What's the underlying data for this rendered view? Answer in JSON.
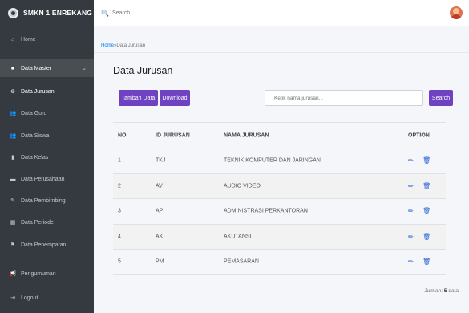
{
  "brand": {
    "name": "SMKN 1 ENREKANG"
  },
  "sidebar": {
    "items": [
      {
        "label": "Home",
        "icon": "home-icon",
        "glyph": "⌂"
      },
      {
        "label": "Data Master",
        "icon": "folder-icon",
        "glyph": "■"
      },
      {
        "label": "Data Jurusan",
        "icon": "compass-icon",
        "glyph": "⊕"
      },
      {
        "label": "Data Guru",
        "icon": "users-icon",
        "glyph": "👥"
      },
      {
        "label": "Data Siswa",
        "icon": "users-icon",
        "glyph": "👥"
      },
      {
        "label": "Data Kelas",
        "icon": "door-icon",
        "glyph": "▮"
      },
      {
        "label": "Data Perusahaan",
        "icon": "building-icon",
        "glyph": "▬"
      },
      {
        "label": "Data Pembimbing",
        "icon": "handshake-icon",
        "glyph": "✎"
      },
      {
        "label": "Data Periode",
        "icon": "calendar-icon",
        "glyph": "▦"
      },
      {
        "label": "Data Penempatan",
        "icon": "flag-icon",
        "glyph": "⚑"
      },
      {
        "label": "Pengumuman",
        "icon": "announcement-icon",
        "glyph": "📢"
      },
      {
        "label": "Logout",
        "icon": "logout-icon",
        "glyph": "⇥"
      }
    ],
    "chevron": "⌄"
  },
  "topbar": {
    "search_placeholder": "Search",
    "search_icon": "🔍"
  },
  "breadcrumb": {
    "home": "Home",
    "separator": " » ",
    "current": "Data Jurusan"
  },
  "page": {
    "title": "Data Jurusan"
  },
  "toolbar": {
    "add_label": "Tambah Data",
    "download_label": "Download",
    "search_placeholder": "Ketik nama jurusan...",
    "search_label": "Search"
  },
  "table": {
    "headers": {
      "no": "NO.",
      "id": "ID JURUSAN",
      "name": "NAMA JURUSAN",
      "option": "OPTION"
    },
    "rows": [
      {
        "no": "1",
        "id": "TKJ",
        "name": "TEKNIK KOMPUTER DAN JARINGAN"
      },
      {
        "no": "2",
        "id": "AV",
        "name": "AUDIO VIDEO"
      },
      {
        "no": "3",
        "id": "AP",
        "name": "ADMINISTRASI PERKANTORAN"
      },
      {
        "no": "4",
        "id": "AK",
        "name": "AKUTANSI"
      },
      {
        "no": "5",
        "id": "PM",
        "name": "PEMASARAN"
      }
    ],
    "edit_glyph": "✏",
    "delete_glyph": "🗑"
  },
  "footer": {
    "count_label": "Jumlah:",
    "count_value": "5",
    "count_suffix": "data"
  },
  "colors": {
    "sidebar": "#343a40",
    "accent": "#6f42c1",
    "link": "#007bff"
  }
}
